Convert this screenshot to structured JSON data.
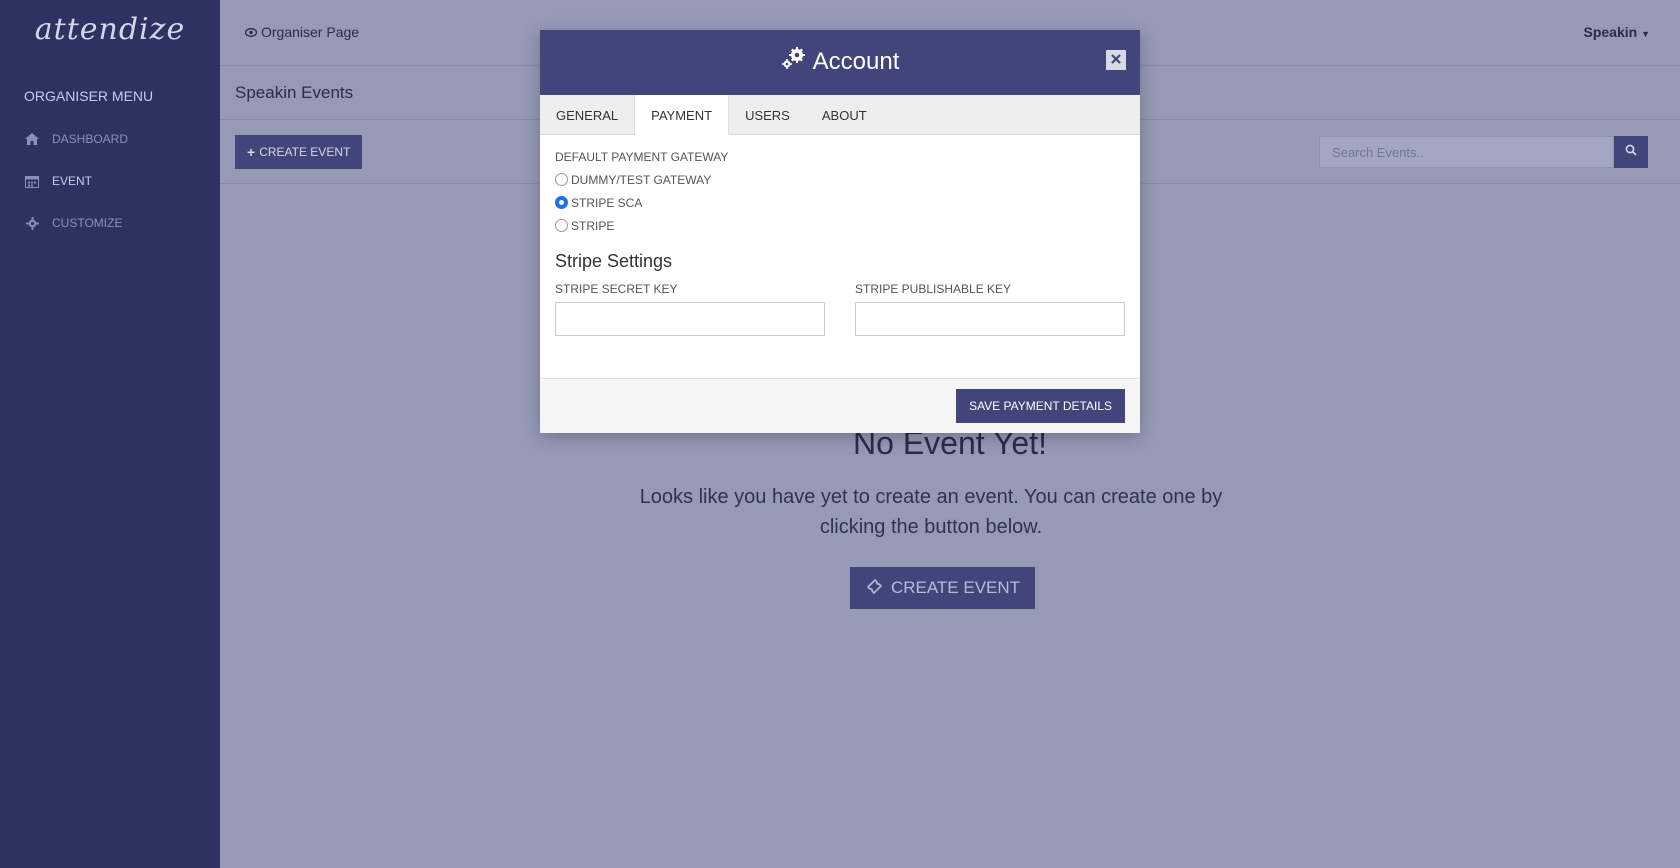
{
  "sidebar": {
    "logo": "attendize",
    "menu_title": "ORGANISER MENU",
    "items": [
      {
        "label": "DASHBOARD",
        "icon": "home-icon"
      },
      {
        "label": "EVENT",
        "icon": "calendar-icon"
      },
      {
        "label": "CUSTOMIZE",
        "icon": "gear-icon"
      }
    ]
  },
  "topbar": {
    "organiser_page_label": "Organiser Page",
    "user_label": "Speakin"
  },
  "page": {
    "title": "Speakin Events",
    "create_event_label": "CREATE EVENT",
    "search_placeholder": "Search Events.."
  },
  "empty_state": {
    "title": "No Event Yet!",
    "description": "Looks like you have yet to create an event. You can create one by clicking the button below.",
    "button_label": "CREATE EVENT"
  },
  "modal": {
    "title": "Account",
    "tabs": [
      {
        "label": "GENERAL",
        "active": false
      },
      {
        "label": "PAYMENT",
        "active": true
      },
      {
        "label": "USERS",
        "active": false
      },
      {
        "label": "ABOUT",
        "active": false
      }
    ],
    "gateway_label": "DEFAULT PAYMENT GATEWAY",
    "gateways": [
      {
        "label": "DUMMY/TEST GATEWAY",
        "checked": false
      },
      {
        "label": "STRIPE SCA",
        "checked": true
      },
      {
        "label": "STRIPE",
        "checked": false
      }
    ],
    "stripe_settings_title": "Stripe Settings",
    "secret_key_label": "STRIPE SECRET KEY",
    "secret_key_value": "",
    "publishable_key_label": "STRIPE PUBLISHABLE KEY",
    "publishable_key_value": "",
    "save_label": "SAVE PAYMENT DETAILS"
  },
  "colors": {
    "sidebar_bg": "#2e3263",
    "accent": "#41457a",
    "radio_checked": "#1a73e8"
  }
}
